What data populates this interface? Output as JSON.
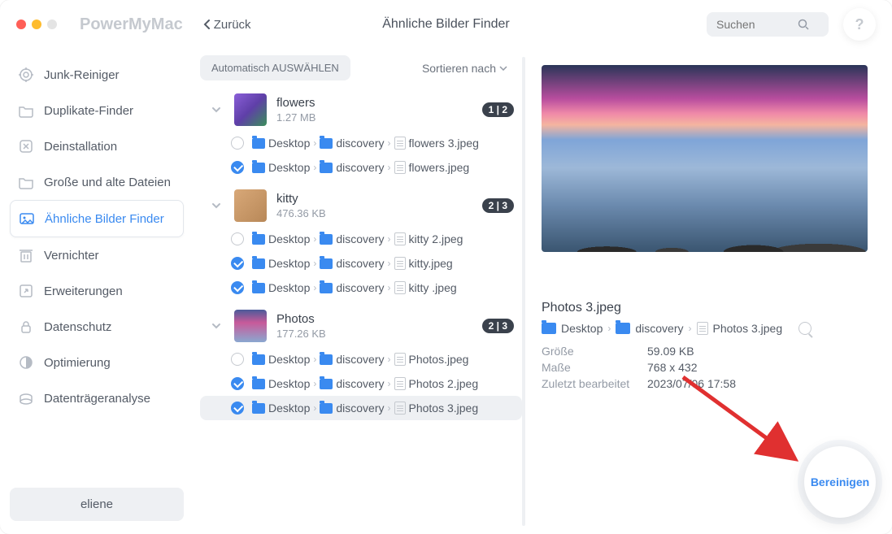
{
  "app_name": "PowerMyMac",
  "back_label": "Zurück",
  "page_title": "Ähnliche Bilder Finder",
  "search_placeholder": "Suchen",
  "help": "?",
  "sidebar": {
    "items": [
      {
        "label": "Junk-Reiniger"
      },
      {
        "label": "Duplikate-Finder"
      },
      {
        "label": "Deinstallation"
      },
      {
        "label": "Große und alte Dateien"
      },
      {
        "label": "Ähnliche Bilder Finder"
      },
      {
        "label": "Vernichter"
      },
      {
        "label": "Erweiterungen"
      },
      {
        "label": "Datenschutz"
      },
      {
        "label": "Optimierung"
      },
      {
        "label": "Datenträgeranalyse"
      }
    ],
    "user": "eliene"
  },
  "toolbar": {
    "auto_select": "Automatisch AUSWÄHLEN",
    "sort_by": "Sortieren nach"
  },
  "groups": [
    {
      "name": "flowers",
      "size": "1.27 MB",
      "badge": "1 | 2",
      "files": [
        {
          "checked": false,
          "segments": [
            "Desktop",
            "discovery"
          ],
          "filename": "flowers 3.jpeg",
          "selected": false
        },
        {
          "checked": true,
          "segments": [
            "Desktop",
            "discovery"
          ],
          "filename": "flowers.jpeg",
          "selected": false
        }
      ]
    },
    {
      "name": "kitty",
      "size": "476.36 KB",
      "badge": "2 | 3",
      "files": [
        {
          "checked": false,
          "segments": [
            "Desktop",
            "discovery"
          ],
          "filename": "kitty 2.jpeg",
          "selected": false
        },
        {
          "checked": true,
          "segments": [
            "Desktop",
            "discovery"
          ],
          "filename": "kitty.jpeg",
          "selected": false
        },
        {
          "checked": true,
          "segments": [
            "Desktop",
            "discovery"
          ],
          "filename": "kitty .jpeg",
          "selected": false
        }
      ]
    },
    {
      "name": "Photos",
      "size": "177.26 KB",
      "badge": "2 | 3",
      "files": [
        {
          "checked": false,
          "segments": [
            "Desktop",
            "discovery"
          ],
          "filename": "Photos.jpeg",
          "selected": false
        },
        {
          "checked": true,
          "segments": [
            "Desktop",
            "discovery"
          ],
          "filename": "Photos 2.jpeg",
          "selected": false
        },
        {
          "checked": true,
          "segments": [
            "Desktop",
            "discovery"
          ],
          "filename": "Photos 3.jpeg",
          "selected": true
        }
      ]
    }
  ],
  "detail": {
    "name": "Photos 3.jpeg",
    "path_segments": [
      "Desktop",
      "discovery"
    ],
    "path_file": "Photos 3.jpeg",
    "meta": [
      {
        "k": "Größe",
        "v": "59.09 KB"
      },
      {
        "k": "Maße",
        "v": "768 x 432"
      },
      {
        "k": "Zuletzt bearbeitet",
        "v": "2023/07/06 17:58"
      }
    ]
  },
  "clean_label": "Bereinigen"
}
